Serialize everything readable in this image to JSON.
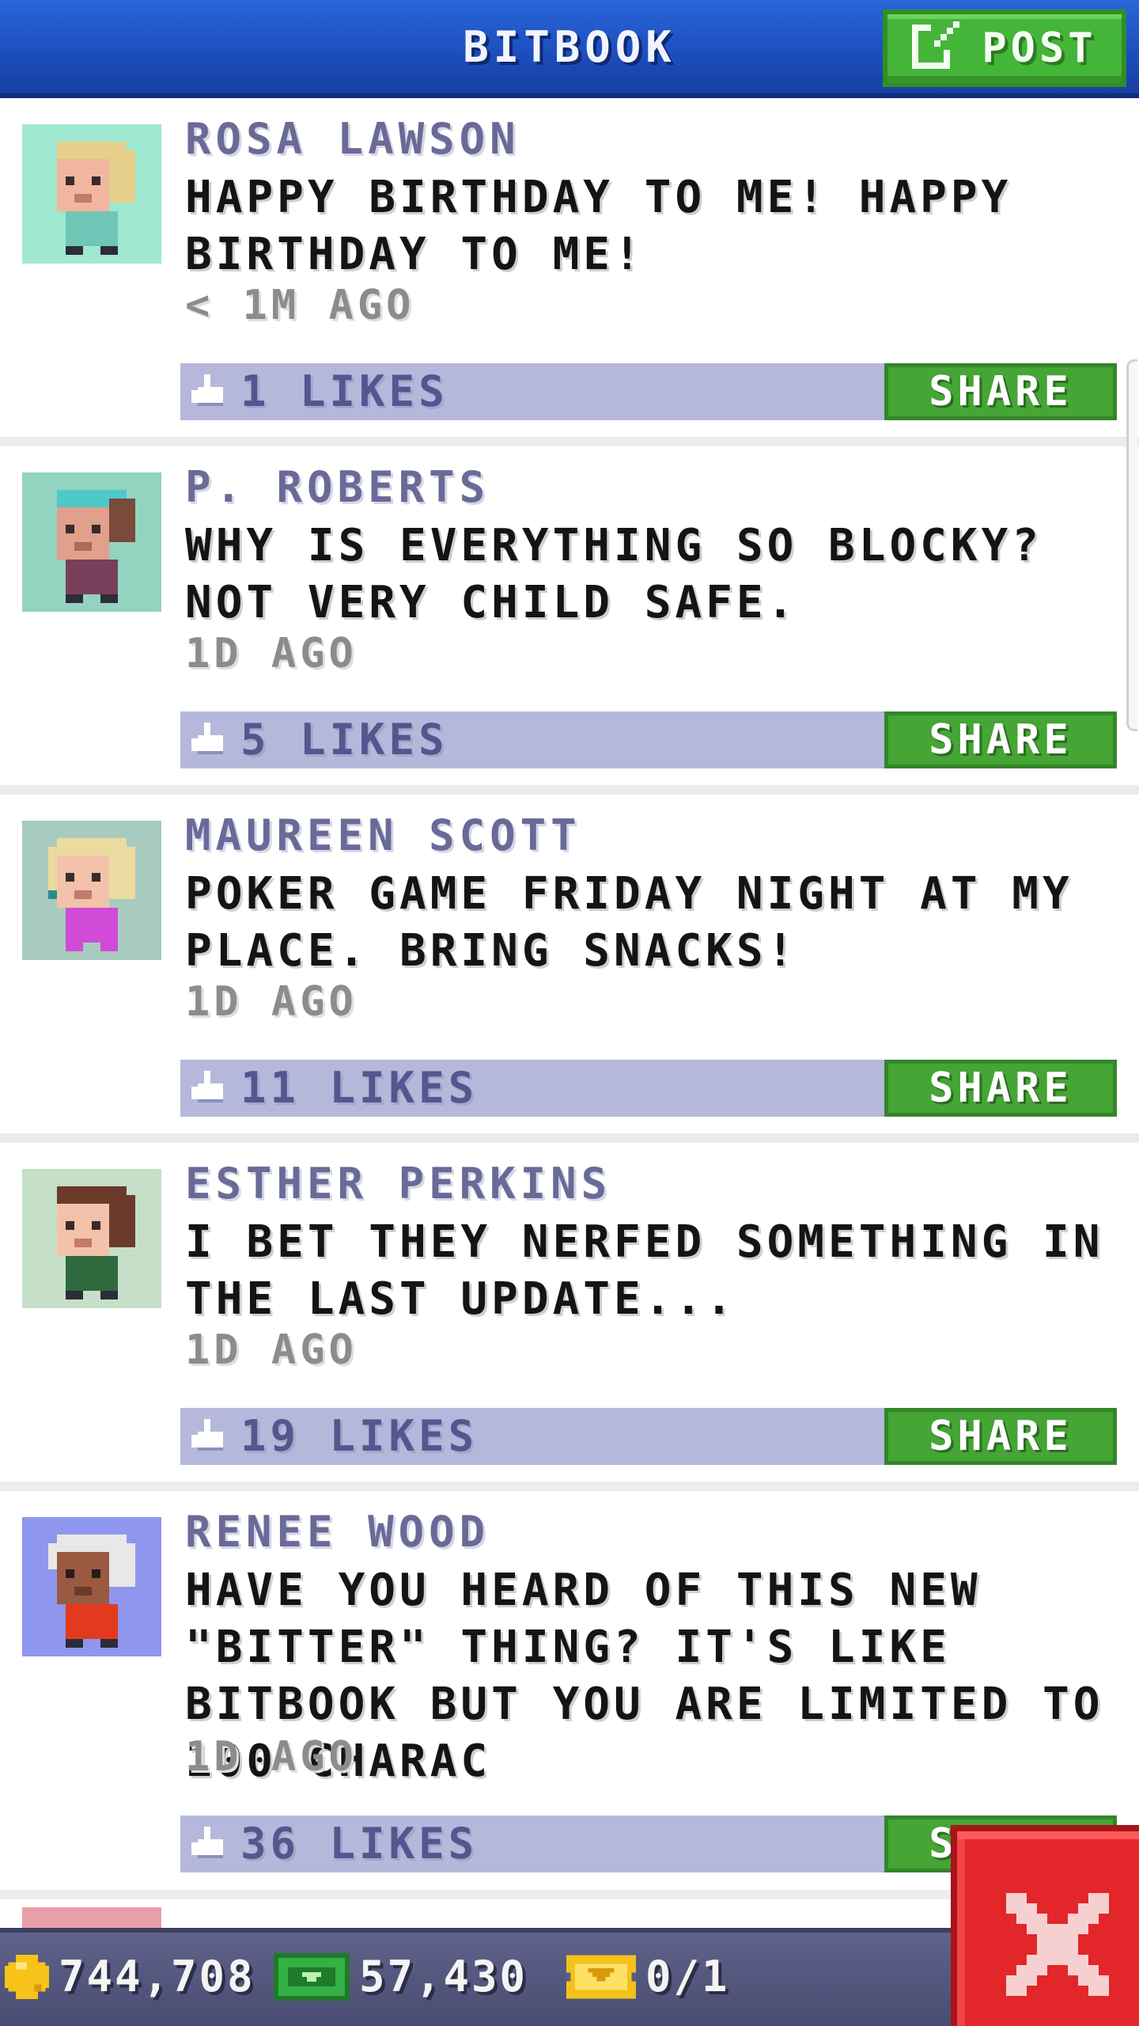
{
  "header": {
    "title": "BITBOOK",
    "post_label": "POST"
  },
  "posts": [
    {
      "name": "ROSA LAWSON",
      "message": "HAPPY BIRTHDAY TO ME! HAPPY BIRTHDAY TO ME!",
      "time": "< 1M AGO",
      "likes": "1 LIKES",
      "share_label": "SHARE",
      "avatar_bg": "#9ee9cf"
    },
    {
      "name": "P. ROBERTS",
      "message": "WHY IS EVERYTHING SO BLOCKY? NOT VERY CHILD SAFE.",
      "time": "1D AGO",
      "likes": "5 LIKES",
      "share_label": "SHARE",
      "avatar_bg": "#92d4c0"
    },
    {
      "name": "MAUREEN SCOTT",
      "message": "POKER GAME FRIDAY NIGHT AT MY PLACE. BRING SNACKS!",
      "time": "1D AGO",
      "likes": "11 LIKES",
      "share_label": "SHARE",
      "avatar_bg": "#a8cbc0"
    },
    {
      "name": "ESTHER PERKINS",
      "message": "I BET THEY NERFED SOMETHING IN THE LAST UPDATE...",
      "time": "1D AGO",
      "likes": "19 LIKES",
      "share_label": "SHARE",
      "avatar_bg": "#c5dfc9"
    },
    {
      "name": "RENEE WOOD",
      "message": "HAVE YOU HEARD OF THIS NEW \"BITTER\" THING? IT'S LIKE BITBOOK BUT YOU ARE LIMITED TO 100 CHARAC",
      "time": "1D AGO",
      "likes": "36 LIKES",
      "share_label": "SHARE",
      "avatar_bg": "#8f96ee"
    }
  ],
  "status_bar": {
    "coins": "744,708",
    "bux": "57,430",
    "tickets": "0/1"
  },
  "icons": {
    "post": "compose-icon",
    "like": "thumbs-up-icon",
    "coin": "coin-icon",
    "bux": "bux-icon",
    "ticket": "ticket-icon",
    "close": "close-icon"
  },
  "colors": {
    "header_blue": "#1d4fbf",
    "button_green": "#45a535",
    "likes_bar": "#b5b8da",
    "close_red": "#e3262a"
  }
}
